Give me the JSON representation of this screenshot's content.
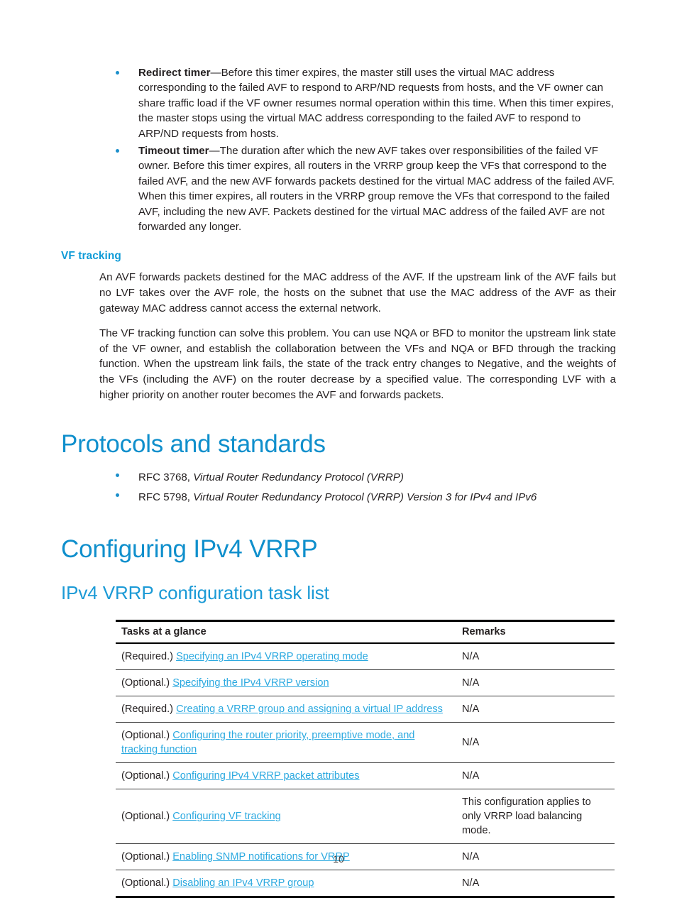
{
  "document": {
    "page_number": "10"
  },
  "colors": {
    "heading_blue": "#0f8fcc",
    "subheading_blue": "#1b9ad6",
    "h3_blue": "#0f9bd7",
    "link_blue": "#2ba9e0",
    "bullet_blue": "#1b8fcb",
    "body_text": "#231f20"
  },
  "timer_bullets": [
    {
      "term": "Redirect timer",
      "text": "—Before this timer expires, the master still uses the virtual MAC address corresponding to the failed AVF to respond to ARP/ND requests from hosts, and the VF owner can share traffic load if the VF owner resumes normal operation within this time. When this timer expires, the master stops using the virtual MAC address corresponding to the failed AVF to respond to ARP/ND requests from hosts."
    },
    {
      "term": "Timeout timer",
      "text": "—The duration after which the new AVF takes over responsibilities of the failed VF owner. Before this timer expires, all routers in the VRRP group keep the VFs that correspond to the failed AVF, and the new AVF forwards packets destined for the virtual MAC address of the failed AVF. When this timer expires, all routers in the VRRP group remove the VFs that correspond to the failed AVF, including the new AVF. Packets destined for the virtual MAC address of the failed AVF are not forwarded any longer."
    }
  ],
  "vf_tracking": {
    "heading": "VF tracking",
    "paragraph_1": "An AVF forwards packets destined for the MAC address of the AVF. If the upstream link of the AVF fails but no LVF takes over the AVF role, the hosts on the subnet that use the MAC address of the AVF as their gateway MAC address cannot access the external network.",
    "paragraph_2": "The VF tracking function can solve this problem. You can use NQA or BFD to monitor the upstream link state of the VF owner, and establish the collaboration between the VFs and NQA or BFD through the tracking function. When the upstream link fails, the state of the track entry changes to Negative, and the weights of the VFs (including the AVF) on the router decrease by a specified value. The corresponding LVF with a higher priority on another router becomes the AVF and forwards packets."
  },
  "protocols": {
    "heading": "Protocols and standards",
    "items": [
      {
        "prefix": "RFC 3768, ",
        "title": "Virtual Router Redundancy Protocol (VRRP)"
      },
      {
        "prefix": "RFC 5798, ",
        "title": "Virtual Router Redundancy Protocol (VRRP) Version 3 for IPv4 and IPv6"
      }
    ]
  },
  "configuring_ipv4_vrrp": {
    "heading": "Configuring IPv4 VRRP",
    "subheading": "IPv4 VRRP configuration task list",
    "table": {
      "headers": [
        "Tasks at a glance",
        "Remarks"
      ],
      "rows": [
        {
          "requirement": "(Required.) ",
          "link": "Specifying an IPv4 VRRP operating mode",
          "remarks": "N/A"
        },
        {
          "requirement": "(Optional.) ",
          "link": "Specifying the IPv4 VRRP version",
          "remarks": "N/A"
        },
        {
          "requirement": "(Required.) ",
          "link": "Creating a VRRP group and assigning a virtual IP address",
          "remarks": "N/A"
        },
        {
          "requirement": "(Optional.) ",
          "link": "Configuring the router priority, preemptive mode, and tracking function",
          "remarks": "N/A"
        },
        {
          "requirement": "(Optional.) ",
          "link": "Configuring IPv4 VRRP packet attributes",
          "remarks": "N/A"
        },
        {
          "requirement": "(Optional.) ",
          "link": "Configuring VF tracking",
          "remarks": "This configuration applies to only VRRP load balancing mode."
        },
        {
          "requirement": "(Optional.) ",
          "link": "Enabling SNMP notifications for VRRP",
          "remarks": "N/A"
        },
        {
          "requirement": "(Optional.) ",
          "link": "Disabling an IPv4 VRRP group",
          "remarks": "N/A"
        }
      ]
    }
  }
}
